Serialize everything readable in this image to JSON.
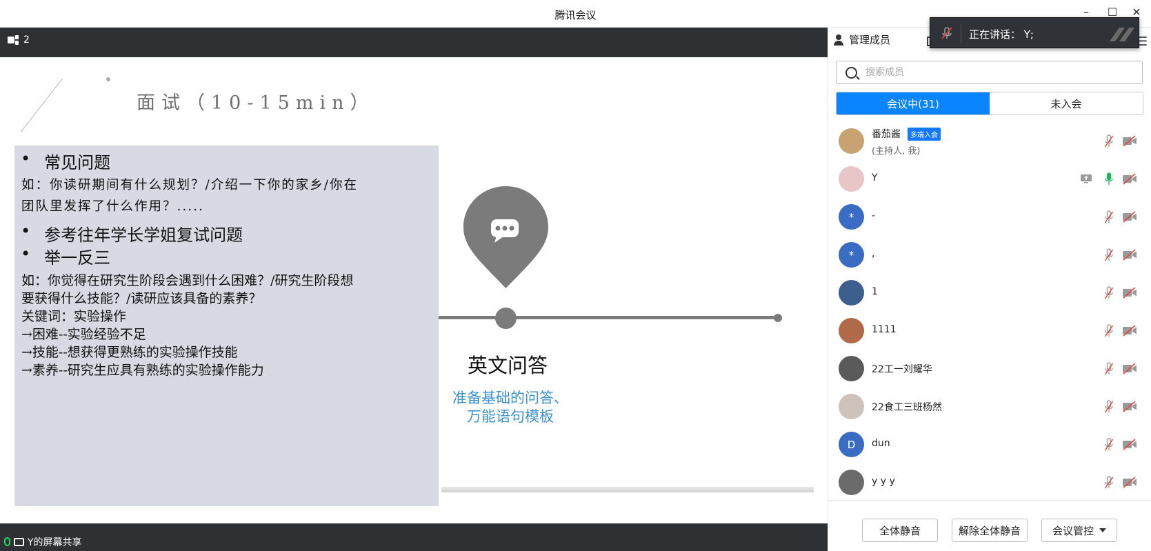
{
  "window": {
    "title": "腾讯会议",
    "minimize": "–",
    "maximize": "☐",
    "close": "✕"
  },
  "share_bar": {
    "view_count": "2",
    "sharer_label": "Y的屏幕共享"
  },
  "slide": {
    "title": "面试（10-15min）",
    "bullet_mark": "•",
    "bullets": [
      "常见问题",
      "参考往年学长学姐复试问题",
      "举一反三"
    ],
    "q1_line1": "如：你读研期间有什么规划？/介绍一下你的家乡/你在",
    "q1_line2": "团队里发挥了什么作用？.....",
    "ex_lines": [
      "如：你觉得在研究生阶段会遇到什么困难？/研究生阶段想",
      "要获得什么技能？/读研应该具备的素养？",
      "关键词：实验操作",
      "→困难--实验经验不足",
      "→技能--想获得更熟练的实验操作技能",
      "→素养--研究生应具有熟练的实验操作能力"
    ],
    "english_title": "英文问答",
    "english_sub_line1": "准备基础的问答、",
    "english_sub_line2": "万能语句模板"
  },
  "toast": {
    "text": "正在讲话：  Y;"
  },
  "side": {
    "tab_label": "管理成员",
    "search_placeholder": "搜索成员",
    "tabs": [
      "会议中(31)",
      "未入会"
    ],
    "members": [
      {
        "name": "番茄酱",
        "badge": "多端入会",
        "role": "(主持人, 我)",
        "avatar": "",
        "av_color": "#c9a271",
        "mic": "muted",
        "share": false
      },
      {
        "name": "Y",
        "badge": "",
        "role": "",
        "avatar": "",
        "av_color": "#e8c5c7",
        "mic": "on",
        "share": true
      },
      {
        "name": "-",
        "badge": "",
        "role": "",
        "avatar": "*",
        "av_color": "#3a6cc4",
        "mic": "muted",
        "share": false
      },
      {
        "name": ",",
        "badge": "",
        "role": "",
        "avatar": "*",
        "av_color": "#3a6cc4",
        "mic": "muted",
        "share": false
      },
      {
        "name": "1",
        "badge": "",
        "role": "",
        "avatar": "",
        "av_color": "#3d5f8e",
        "mic": "muted",
        "share": false
      },
      {
        "name": "1111",
        "badge": "",
        "role": "",
        "avatar": "",
        "av_color": "#b06a4a",
        "mic": "muted",
        "share": false
      },
      {
        "name": "22工一刘耀华",
        "badge": "",
        "role": "",
        "avatar": "",
        "av_color": "#5a5a5a",
        "mic": "muted",
        "share": false
      },
      {
        "name": "22食工三班杨然",
        "badge": "",
        "role": "",
        "avatar": "",
        "av_color": "#cfc2bb",
        "mic": "muted",
        "share": false
      },
      {
        "name": "dun",
        "badge": "",
        "role": "",
        "avatar": "D",
        "av_color": "#3a6cc4",
        "mic": "muted",
        "share": false
      },
      {
        "name": "y y y",
        "badge": "",
        "role": "",
        "avatar": "",
        "av_color": "#6b6b6b",
        "mic": "muted",
        "share": false
      }
    ],
    "footer": {
      "mute_all": "全体静音",
      "unmute_all": "解除全体静音",
      "manage": "会议管控"
    }
  }
}
